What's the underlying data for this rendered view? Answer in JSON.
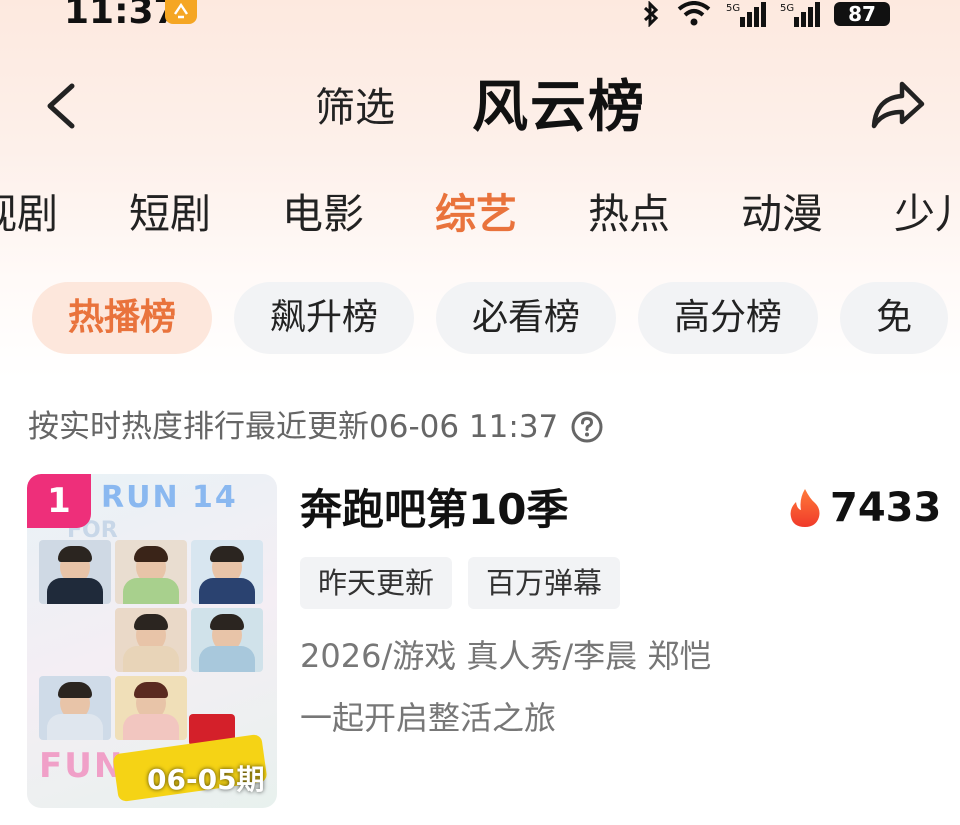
{
  "status_bar": {
    "time": "11:37",
    "battery": "87",
    "icons": [
      "bluetooth-icon",
      "wifi-icon",
      "signal-5g-icon",
      "signal-5g-icon"
    ]
  },
  "header": {
    "back_icon": "chevron-left-icon",
    "filter_label": "筛选",
    "title": "风云榜",
    "share_icon": "share-icon"
  },
  "tabs": [
    "视剧",
    "短剧",
    "电影",
    "综艺",
    "热点",
    "动漫",
    "少儿"
  ],
  "active_tab": "综艺",
  "chips": [
    "热播榜",
    "飙升榜",
    "必看榜",
    "高分榜",
    "免"
  ],
  "active_chip": "热播榜",
  "info_line": {
    "text": "按实时热度排行最近更新06-06 11:37",
    "help_icon": "question-circle-icon"
  },
  "list": [
    {
      "rank": "1",
      "title": "奔跑吧第10季",
      "heat": "7433",
      "heat_icon": "flame-icon",
      "tags": [
        "昨天更新",
        "百万弹幕"
      ],
      "meta": "2026/游戏 真人秀/李晨 郑恺",
      "description": "一起开启整活之旅",
      "poster": {
        "episode": "06-05期",
        "graphic_text_1": "RUN 14",
        "graphic_text_2": "FOR",
        "graphic_text_3": "FUN"
      }
    }
  ],
  "colors": {
    "accent": "#e9733c",
    "rank_badge": "#ee2f7a",
    "chip_bg": "#f2f3f5",
    "chip_active_bg": "#fde7dc"
  }
}
